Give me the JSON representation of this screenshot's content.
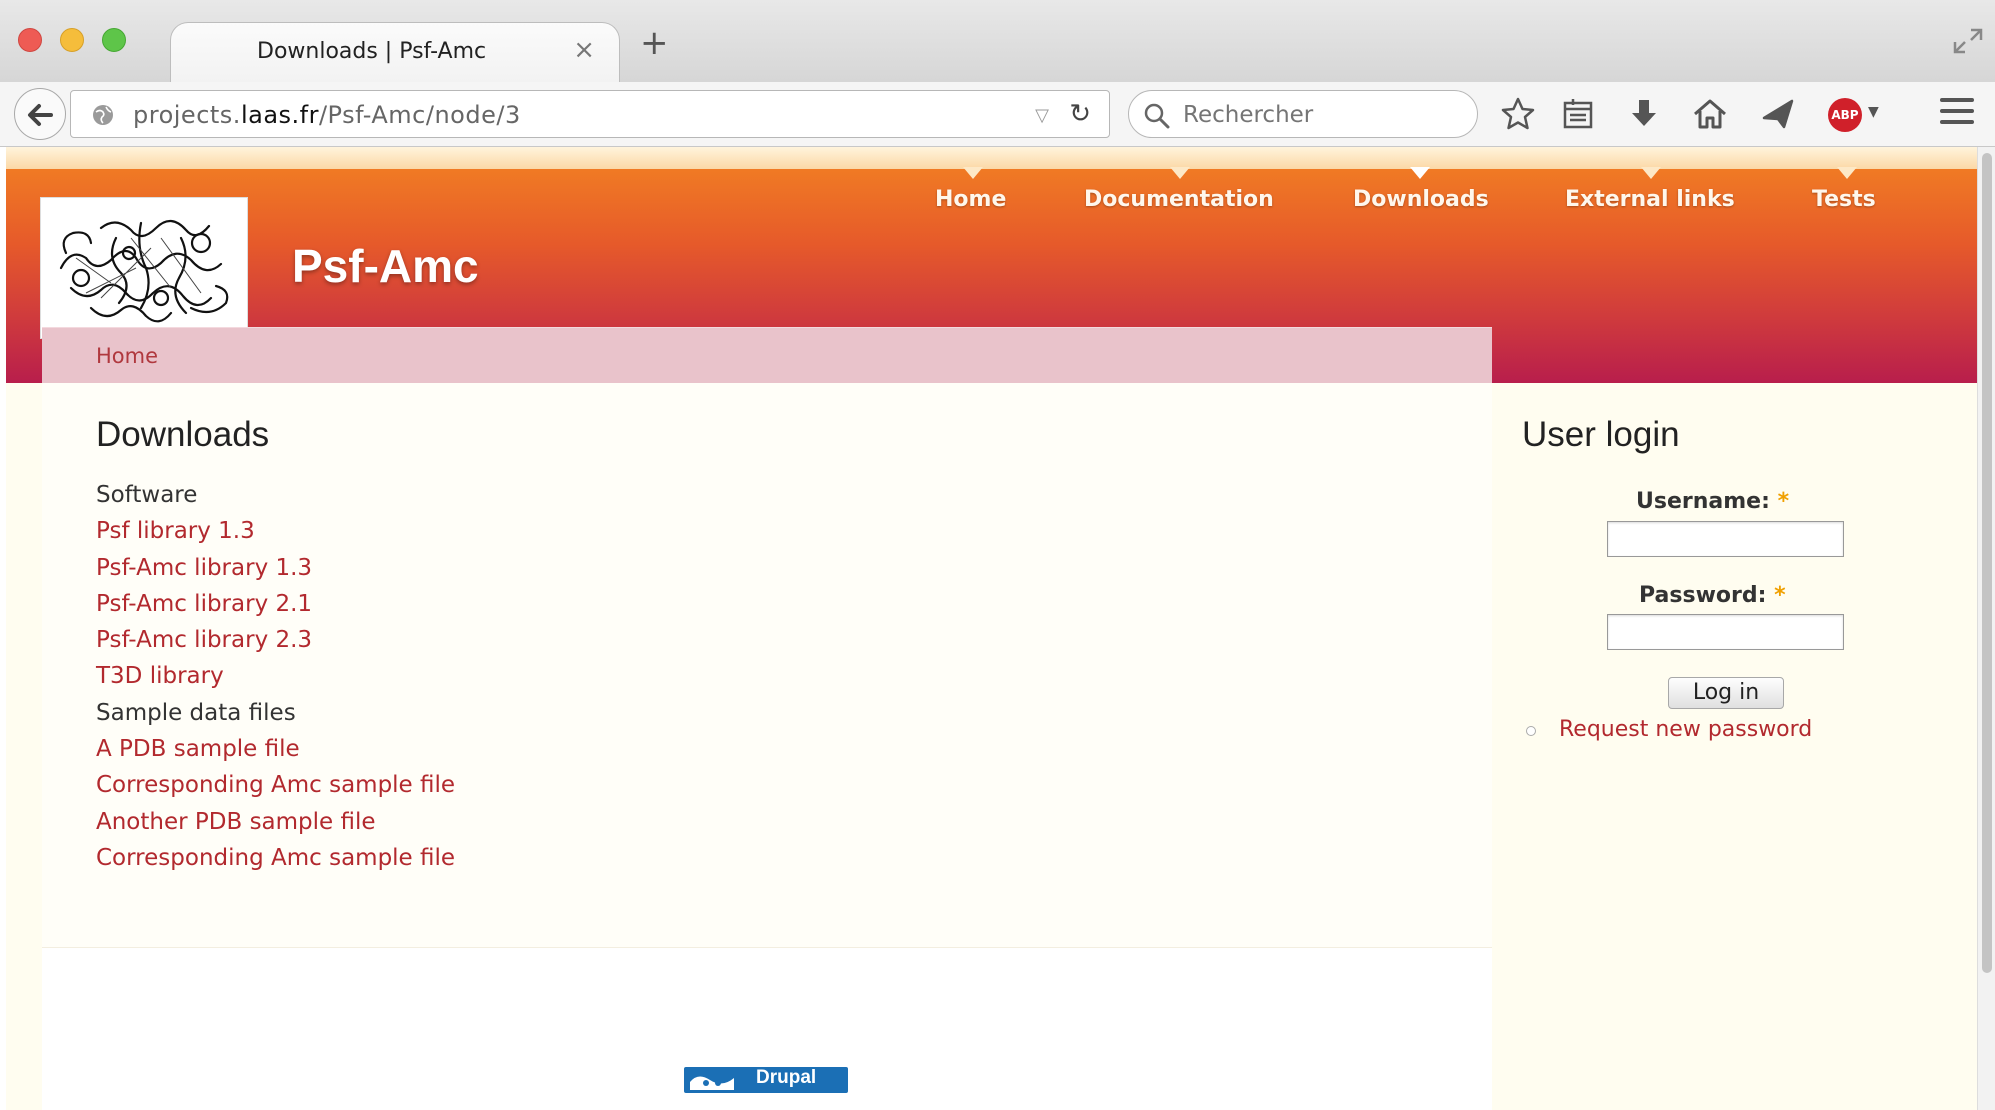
{
  "browser": {
    "tab_title": "Downloads | Psf-Amc",
    "tab_close": "×",
    "new_tab": "+",
    "url_prefix": "projects.",
    "url_host": "laas.fr",
    "url_path": "/Psf-Amc/node/3",
    "search_placeholder": "Rechercher",
    "abp_label": "ABP"
  },
  "site": {
    "name": "Psf-Amc",
    "nav": [
      {
        "label": "Home"
      },
      {
        "label": "Documentation"
      },
      {
        "label": "Downloads"
      },
      {
        "label": "External links"
      },
      {
        "label": "Tests"
      }
    ],
    "breadcrumb": "Home"
  },
  "content": {
    "title": "Downloads",
    "items": [
      {
        "text": "Software",
        "type": "heading"
      },
      {
        "text": "Psf library 1.3",
        "type": "link"
      },
      {
        "text": "Psf-Amc library 1.3",
        "type": "link"
      },
      {
        "text": "Psf-Amc library 2.1",
        "type": "link"
      },
      {
        "text": "Psf-Amc library 2.3",
        "type": "link"
      },
      {
        "text": "T3D library",
        "type": "link"
      },
      {
        "text": "Sample data files",
        "type": "heading"
      },
      {
        "text": "A PDB sample file",
        "type": "link"
      },
      {
        "text": "Corresponding Amc sample file",
        "type": "link"
      },
      {
        "text": "Another PDB sample file",
        "type": "link"
      },
      {
        "text": "Corresponding Amc sample file",
        "type": "link"
      }
    ]
  },
  "login": {
    "title": "User login",
    "username_label": "Username:",
    "password_label": "Password:",
    "required_mark": "*",
    "username_value": "",
    "password_value": "",
    "submit_label": "Log in",
    "request_password": "Request new password"
  },
  "footer": {
    "badge_text": "Drupal"
  },
  "colors": {
    "link": "#b2292e",
    "header_top": "#f07a24",
    "header_bottom": "#b81e4c",
    "breadcrumb_bg": "#e9c3cb",
    "page_bg": "#fffdf0",
    "drupal_blue": "#1b6fb5"
  }
}
